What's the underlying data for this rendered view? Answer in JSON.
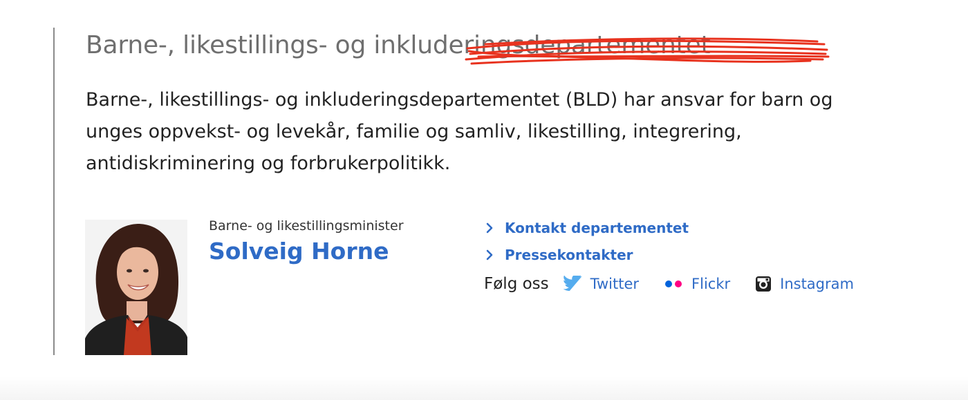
{
  "heading": {
    "title": "Barne-, likestillings- og inkluderingsdepartementet"
  },
  "intro": {
    "text": "Barne-, likestillings- og inkluderingsdepartementet (BLD) har ansvar for barn og unges oppvekst- og levekår, familie og samliv, likestilling, integrering, antidiskriminering og forbrukerpolitikk."
  },
  "minister": {
    "role": "Barne- og likestillingsminister",
    "name": "Solveig Horne"
  },
  "links": [
    {
      "label": "Kontakt departementet",
      "icon": "chevron-right-icon"
    },
    {
      "label": "Pressekontakter",
      "icon": "chevron-right-icon"
    }
  ],
  "follow": {
    "label": "Følg oss",
    "channels": [
      {
        "label": "Twitter",
        "icon": "twitter-bird-icon",
        "color": "#55acee"
      },
      {
        "label": "Flickr",
        "icon": "flickr-dots-icon",
        "color": "#0063dc",
        "color2": "#ff0084"
      },
      {
        "label": "Instagram",
        "icon": "instagram-camera-icon",
        "color": "#222222"
      }
    ]
  },
  "colors": {
    "link": "#2f6bc6",
    "title": "#6f6f6f",
    "strike": "#e8321e"
  }
}
